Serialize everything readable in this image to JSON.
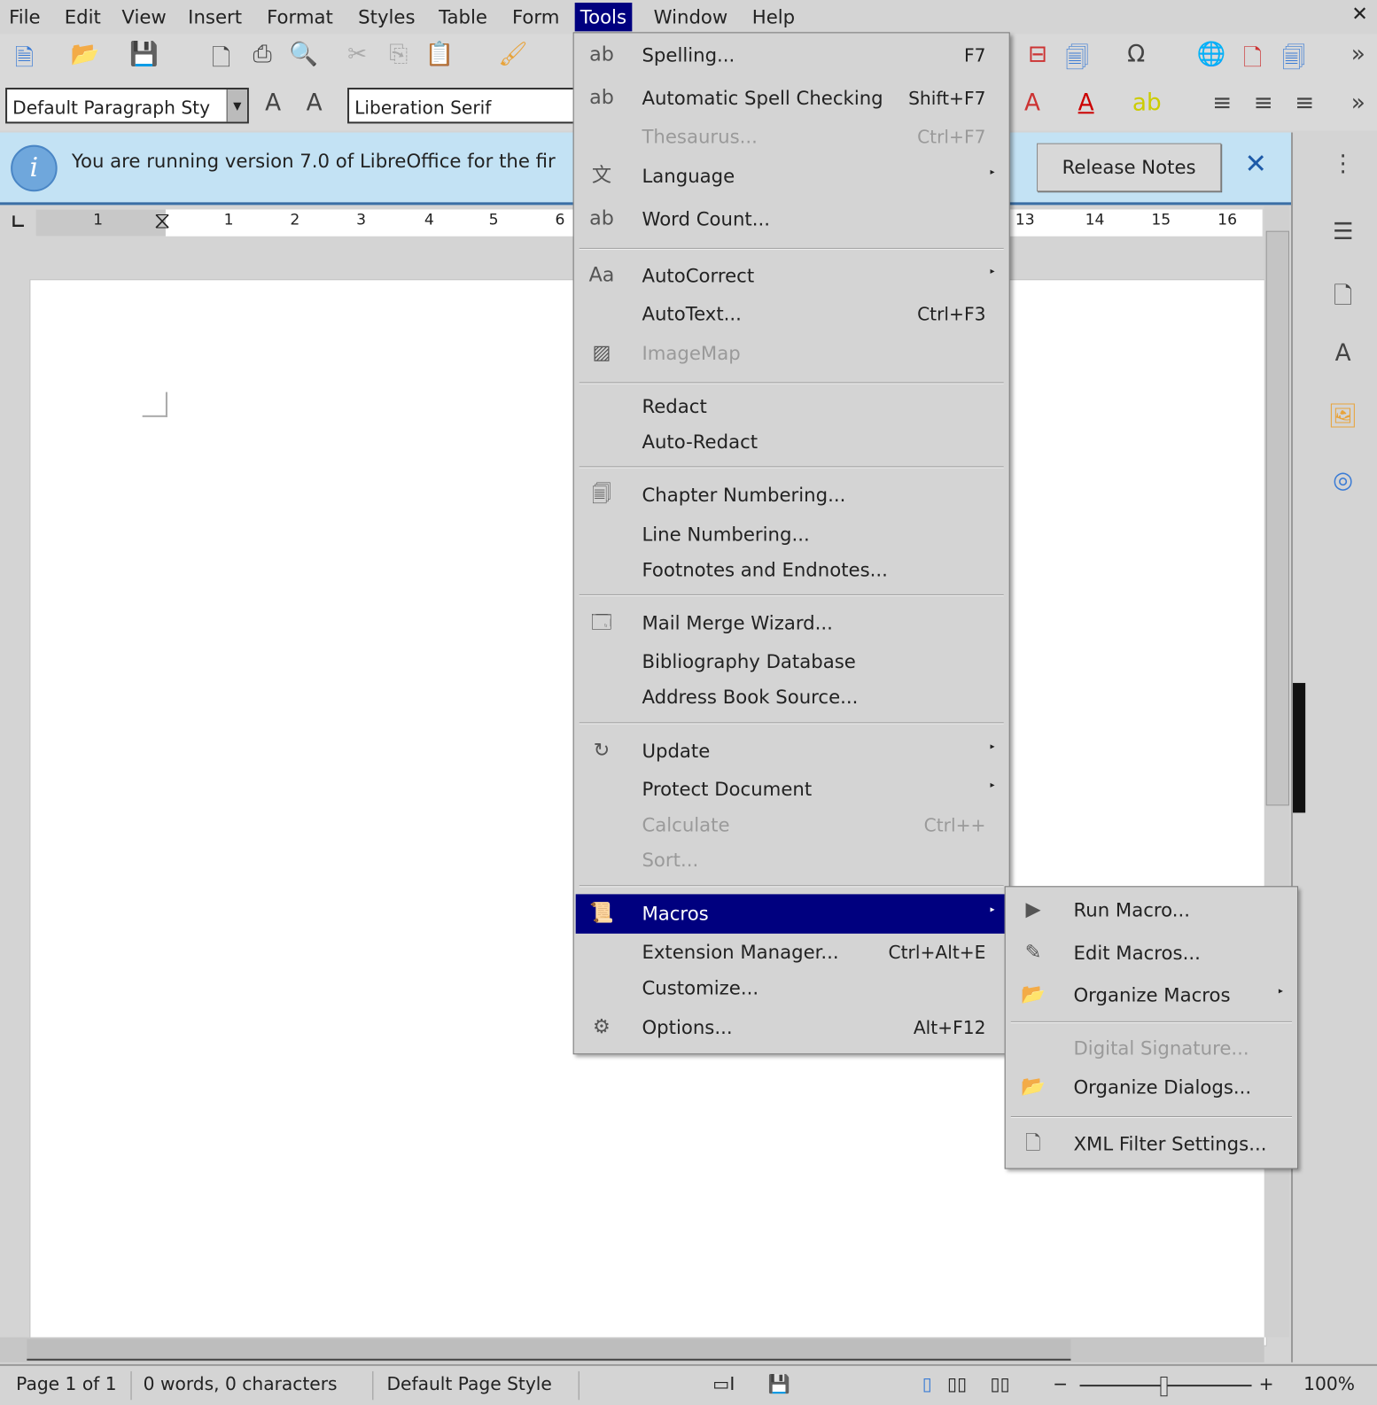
{
  "menubar": {
    "items": [
      "File",
      "Edit",
      "View",
      "Insert",
      "Format",
      "Styles",
      "Table",
      "Form",
      "Tools",
      "Window",
      "Help"
    ],
    "active": "Tools",
    "close": "✕"
  },
  "toolbar": {
    "paragraph_style": "Default Paragraph Sty",
    "font_name": "Liberation Serif"
  },
  "infobar": {
    "text": "You are running version 7.0 of LibreOffice for the fir",
    "button": "Release Notes",
    "close": "✕"
  },
  "ruler": {
    "labels": [
      "1",
      "1",
      "2",
      "3",
      "4",
      "5",
      "6",
      "13",
      "14",
      "15",
      "16"
    ]
  },
  "tools_menu": {
    "items": [
      {
        "label": "Spelling...",
        "shortcut": "F7",
        "icon": "spelling-icon"
      },
      {
        "label": "Automatic Spell Checking",
        "shortcut": "Shift+F7",
        "icon": "auto-spellcheck-icon"
      },
      {
        "label": "Thesaurus...",
        "shortcut": "Ctrl+F7",
        "disabled": true
      },
      {
        "label": "Language",
        "submenu": true,
        "icon": "language-icon"
      },
      {
        "label": "Word Count...",
        "icon": "word-count-icon"
      },
      {
        "label": "AutoCorrect",
        "submenu": true,
        "icon": "autocorrect-icon"
      },
      {
        "label": "AutoText...",
        "shortcut": "Ctrl+F3"
      },
      {
        "label": "ImageMap",
        "disabled": true,
        "icon": "imagemap-icon"
      },
      {
        "label": "Redact"
      },
      {
        "label": "Auto-Redact"
      },
      {
        "label": "Chapter Numbering...",
        "icon": "chapter-numbering-icon"
      },
      {
        "label": "Line Numbering..."
      },
      {
        "label": "Footnotes and Endnotes..."
      },
      {
        "label": "Mail Merge Wizard...",
        "icon": "mail-merge-icon"
      },
      {
        "label": "Bibliography Database"
      },
      {
        "label": "Address Book Source..."
      },
      {
        "label": "Update",
        "submenu": true,
        "icon": "update-icon"
      },
      {
        "label": "Protect Document",
        "submenu": true
      },
      {
        "label": "Calculate",
        "shortcut": "Ctrl++",
        "disabled": true
      },
      {
        "label": "Sort...",
        "disabled": true
      },
      {
        "label": "Macros",
        "submenu": true,
        "highlighted": true,
        "icon": "macros-icon"
      },
      {
        "label": "Extension Manager...",
        "shortcut": "Ctrl+Alt+E"
      },
      {
        "label": "Customize..."
      },
      {
        "label": "Options...",
        "shortcut": "Alt+F12",
        "icon": "options-gear-icon"
      }
    ]
  },
  "macros_submenu": {
    "items": [
      {
        "label": "Run Macro...",
        "icon": "run-macro-icon"
      },
      {
        "label": "Edit Macros...",
        "icon": "edit-macros-icon"
      },
      {
        "label": "Organize Macros",
        "submenu": true,
        "icon": "organize-macros-icon"
      },
      {
        "label": "Digital Signature...",
        "disabled": true
      },
      {
        "label": "Organize Dialogs...",
        "icon": "organize-dialogs-icon"
      },
      {
        "label": "XML Filter Settings...",
        "icon": "xml-filter-icon"
      }
    ]
  },
  "statusbar": {
    "page": "Page 1 of 1",
    "words": "0 words, 0 characters",
    "page_style": "Default Page Style",
    "zoom": "100%"
  },
  "colors": {
    "highlight": "#00007f",
    "infobar": "#c3e2f4"
  }
}
